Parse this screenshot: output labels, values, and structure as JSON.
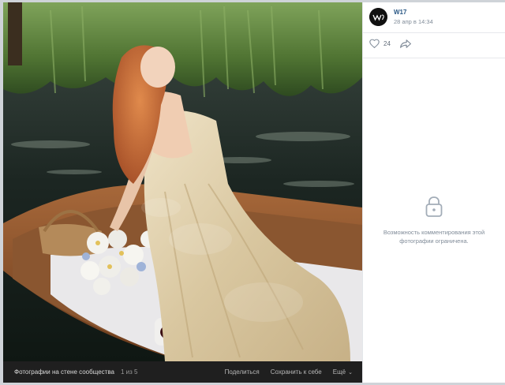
{
  "post": {
    "author": "W17",
    "date": "28 апр в 14:34",
    "likes": "24"
  },
  "comments": {
    "locked_line1": "Возможность комментирования этой",
    "locked_line2": "фотографии ограничена."
  },
  "bottom_bar": {
    "album": "Фотографии на стене сообщества",
    "counter": "1 из 5",
    "share": "Поделиться",
    "save": "Сохранить к себе",
    "more": "Ещё"
  },
  "icons": {
    "avatar": "w17-logo",
    "like": "heart-icon",
    "share": "share-arrow-icon",
    "lock": "lock-icon",
    "more": "chevron-down-icon"
  },
  "colors": {
    "link": "#2a5885",
    "muted": "#818c99",
    "bar_bg": "#1f1f1f"
  }
}
